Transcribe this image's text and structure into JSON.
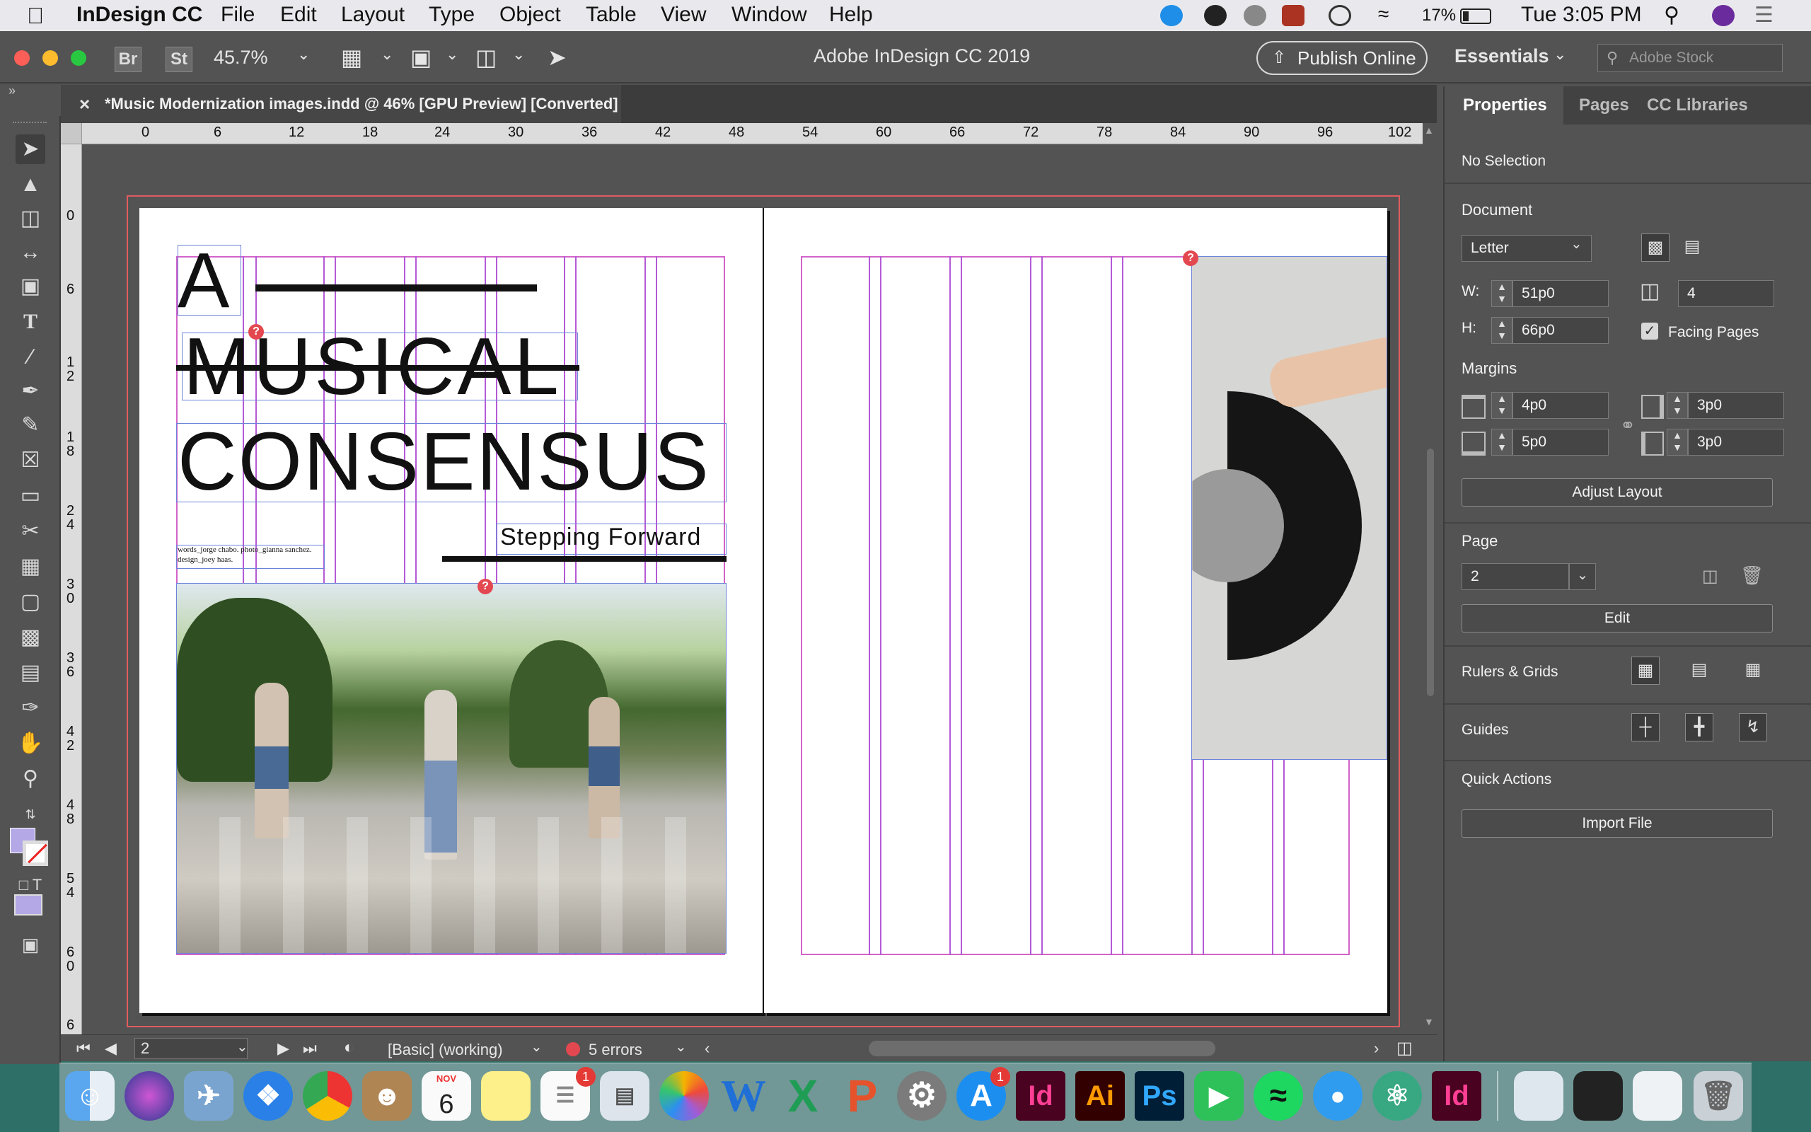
{
  "menubar": {
    "app_name": "InDesign CC",
    "items": [
      "File",
      "Edit",
      "Layout",
      "Type",
      "Object",
      "Table",
      "View",
      "Window",
      "Help"
    ],
    "battery": "17%",
    "clock": "Tue 3:05 PM"
  },
  "controlbar": {
    "bridge_label": "Br",
    "stock_label": "St",
    "zoom": "45.7%",
    "window_title": "Adobe InDesign CC 2019",
    "publish_label": "Publish Online",
    "workspace": "Essentials",
    "search_placeholder": "Adobe Stock"
  },
  "document": {
    "tab_title": "*Music Modernization images.indd @ 46% [GPU Preview] [Converted]"
  },
  "rulers": {
    "h_ticks": [
      "0",
      "6",
      "12",
      "18",
      "24",
      "30",
      "36",
      "42",
      "48",
      "54",
      "60",
      "66",
      "72",
      "78",
      "84",
      "90",
      "96",
      "102"
    ],
    "v_ticks": [
      "0",
      "6",
      "1\n2",
      "1\n8",
      "2\n4",
      "3\n0",
      "3\n6",
      "4\n2",
      "4\n8",
      "5\n4",
      "6\n0",
      "6"
    ]
  },
  "spread": {
    "title_a": "A",
    "title_musical": "MUSICAL",
    "title_consensus": "CONSENSUS",
    "subtitle": "Stepping Forward",
    "credits": "words_jorge chabo. photo_gianna sanchez. design_joey haas."
  },
  "statusbar": {
    "page": "2",
    "style": "[Basic] (working)",
    "errors": "5 errors"
  },
  "properties_panel": {
    "tabs": [
      "Properties",
      "Pages",
      "CC Libraries"
    ],
    "selection": "No Selection",
    "document_label": "Document",
    "page_size": "Letter",
    "w_label": "W:",
    "width": "51p0",
    "h_label": "H:",
    "height": "66p0",
    "page_count": "4",
    "facing_pages_label": "Facing Pages",
    "facing_pages_checked": true,
    "margins_label": "Margins",
    "margin_top": "4p0",
    "margin_bottom": "5p0",
    "margin_inside": "3p0",
    "margin_outside": "3p0",
    "adjust_layout": "Adjust Layout",
    "page_label": "Page",
    "current_page": "2",
    "edit_label": "Edit",
    "rulers_grids": "Rulers & Grids",
    "guides": "Guides",
    "quick_actions": "Quick Actions",
    "import_file": "Import File"
  },
  "dock": {
    "calendar_month": "NOV",
    "calendar_day": "6",
    "reminders_badge": "1",
    "appstore_badge": "1",
    "apps": [
      "Id",
      "Ai",
      "Ps",
      "Id"
    ]
  },
  "colors": {
    "ui_gray": "#535353",
    "guide_purple": "#b45ad6",
    "margin_pink": "#d263c9",
    "error_red": "#e34850"
  }
}
